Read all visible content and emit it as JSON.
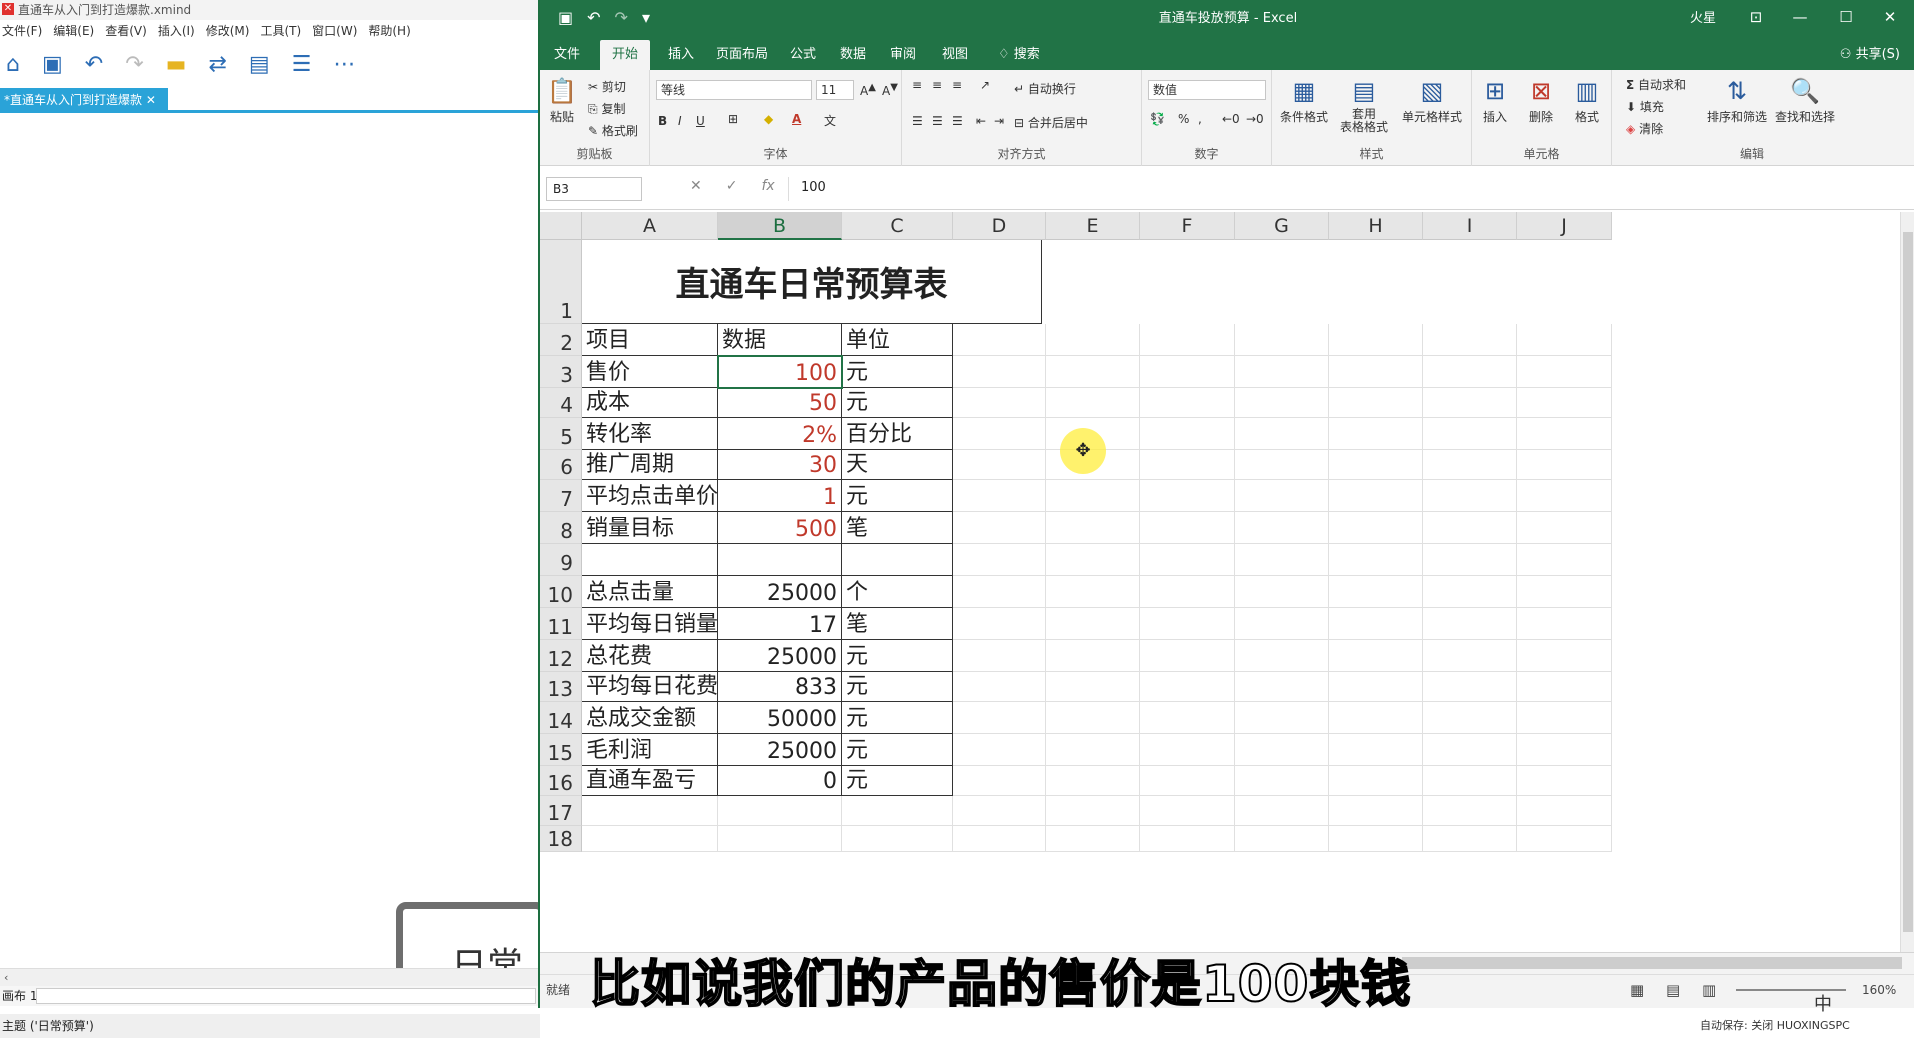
{
  "xmind": {
    "title": "直通车从入门到打造爆款.xmind",
    "menu": [
      "文件(F)",
      "编辑(E)",
      "查看(V)",
      "插入(I)",
      "修改(M)",
      "工具(T)",
      "窗口(W)",
      "帮助(H)"
    ],
    "tab_label": "*直通车从入门到打造爆款",
    "card_text": "日常预",
    "sheet_label": "画布 1",
    "status": "主题 ('日常预算')"
  },
  "excel": {
    "window_title": "直通车投放预算  -  Excel",
    "user": "火星",
    "tabs": [
      "文件",
      "开始",
      "插入",
      "页面布局",
      "公式",
      "数据",
      "审阅",
      "视图",
      "搜索"
    ],
    "share": "共享(S)",
    "ribbon": {
      "paste": "粘贴",
      "cut": "剪切",
      "copy": "复制",
      "format_painter": "格式刷",
      "clipboard": "剪贴板",
      "font_name": "等线",
      "font_size": "11",
      "font_group": "字体",
      "wrap_text": "自动换行",
      "merge_center": "合并后居中",
      "alignment": "对齐方式",
      "number_format": "数值",
      "number_group": "数字",
      "cond_format": "条件格式",
      "table_format_1": "套用",
      "table_format_2": "表格格式",
      "cell_style": "单元格样式",
      "styles": "样式",
      "insert": "插入",
      "delete": "删除",
      "format": "格式",
      "cells": "单元格",
      "autosum": "自动求和",
      "fill": "填充",
      "clear": "清除",
      "sort_filter": "排序和筛选",
      "find_select": "查找和选择",
      "editing": "编辑"
    },
    "name_box": "B3",
    "formula_value": "100",
    "columns": [
      "A",
      "B",
      "C",
      "D",
      "E",
      "F",
      "G",
      "H",
      "I",
      "J"
    ],
    "title_cell": "直通车日常预算表",
    "header_row": [
      "项目",
      "数据",
      "单位"
    ],
    "rows": [
      {
        "n": "3",
        "a": "售价",
        "b": "100",
        "c": "元"
      },
      {
        "n": "4",
        "a": "成本",
        "b": "50",
        "c": "元"
      },
      {
        "n": "5",
        "a": "转化率",
        "b": "2%",
        "c": "百分比"
      },
      {
        "n": "6",
        "a": "推广周期",
        "b": "30",
        "c": "天"
      },
      {
        "n": "7",
        "a": "平均点击单价",
        "b": "1",
        "c": "元"
      },
      {
        "n": "8",
        "a": "销量目标",
        "b": "500",
        "c": "笔"
      },
      {
        "n": "9",
        "a": "",
        "b": "",
        "c": ""
      },
      {
        "n": "10",
        "a": "总点击量",
        "b": "25000",
        "c": "个"
      },
      {
        "n": "11",
        "a": "平均每日销量",
        "b": "17",
        "c": "笔"
      },
      {
        "n": "12",
        "a": "总花费",
        "b": "25000",
        "c": "元"
      },
      {
        "n": "13",
        "a": "平均每日花费",
        "b": "833",
        "c": "元"
      },
      {
        "n": "14",
        "a": "总成交金额",
        "b": "50000",
        "c": "元"
      },
      {
        "n": "15",
        "a": "毛利润",
        "b": "25000",
        "c": "元"
      },
      {
        "n": "16",
        "a": "直通车盈亏",
        "b": "0",
        "c": "元"
      }
    ],
    "extra_rows": [
      "17",
      "18"
    ],
    "status_ready": "就绪",
    "zoom": "160%",
    "autosave": "自动保存: 关闭",
    "pc_name": "HUOXINGSPC",
    "ime": "中"
  },
  "subtitle": "比如说我们的产品的售价是100块钱",
  "colors": {
    "excel_green": "#217346",
    "input_red": "#c0392b",
    "xmind_blue": "#2aa3d8"
  }
}
